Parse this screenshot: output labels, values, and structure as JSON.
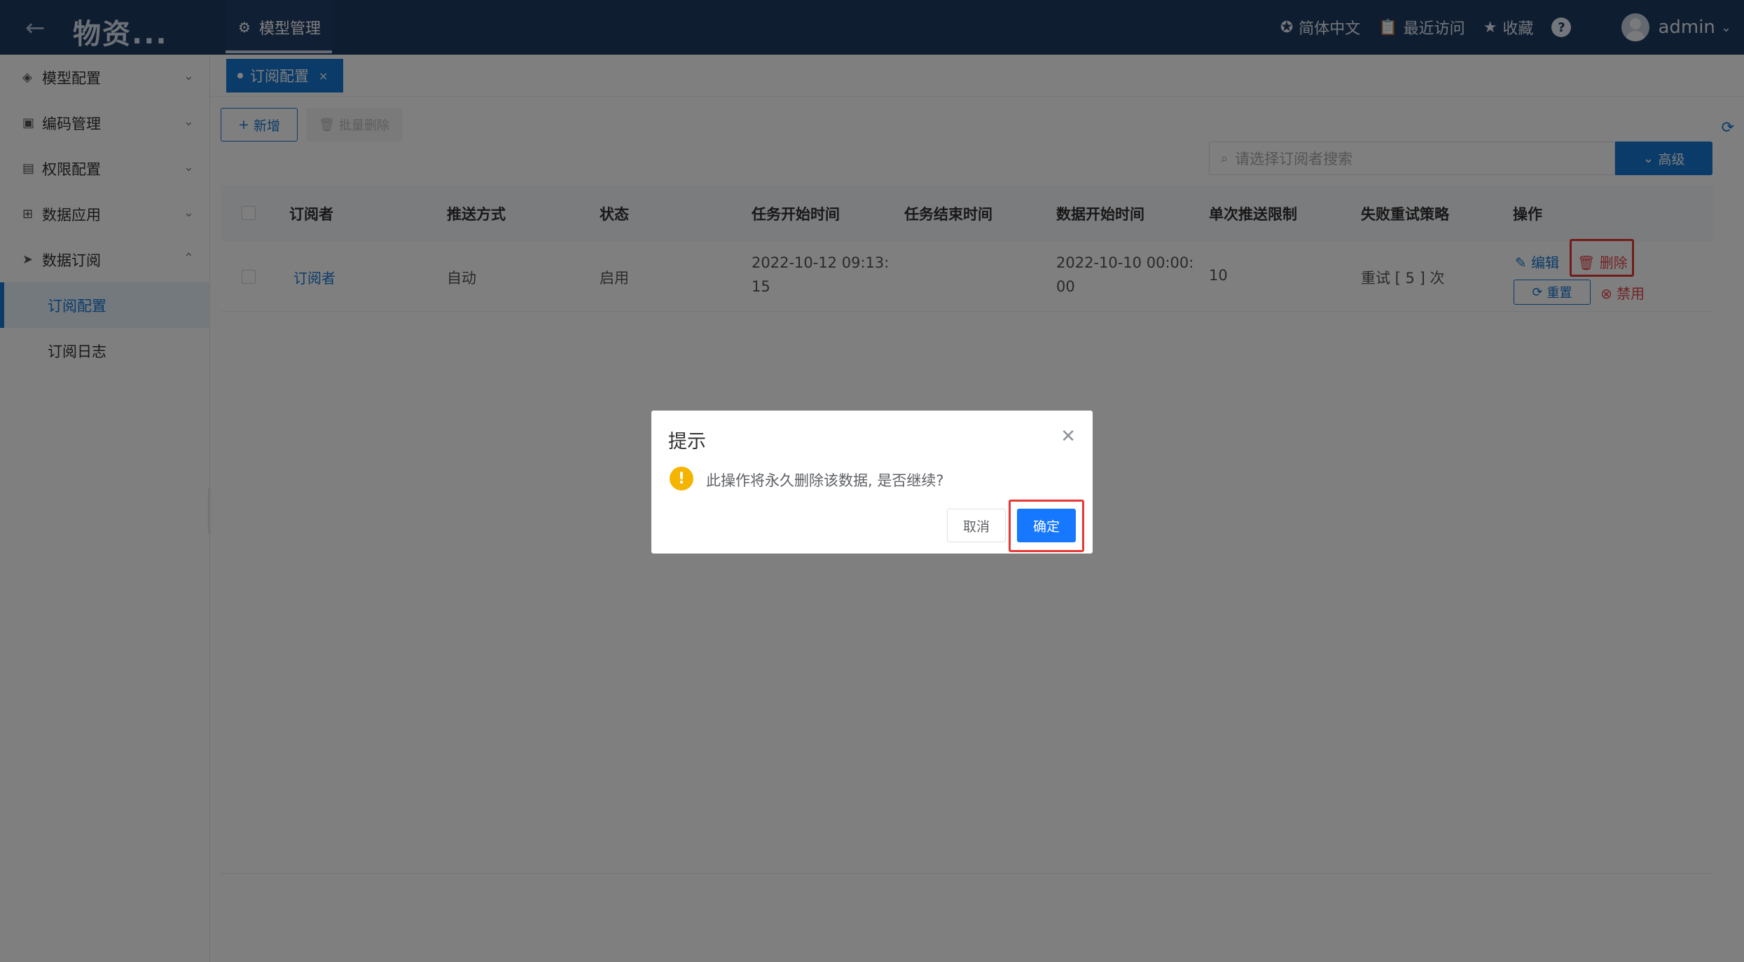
{
  "header": {
    "back_icon": "arrow-left-icon",
    "app_title": "物资...",
    "active_tab": {
      "icon": "gear-icon",
      "label": "模型管理"
    },
    "language": {
      "icon": "globe-icon",
      "label": "简体中文"
    },
    "recent": {
      "icon": "clipboard-icon",
      "label": "最近访问"
    },
    "favorite": {
      "icon": "star-icon",
      "label": "收藏"
    },
    "help": {
      "icon": "help-icon",
      "label": "?"
    },
    "user": {
      "name": "admin"
    }
  },
  "sidebar": {
    "items": [
      {
        "label": "模型配置",
        "icon": "layers-icon",
        "expanded": false
      },
      {
        "label": "编码管理",
        "icon": "code-icon",
        "expanded": false
      },
      {
        "label": "权限配置",
        "icon": "permission-icon",
        "expanded": false
      },
      {
        "label": "数据应用",
        "icon": "apps-icon",
        "expanded": false
      },
      {
        "label": "数据订阅",
        "icon": "send-icon",
        "expanded": true
      }
    ],
    "subitems": [
      {
        "label": "订阅配置",
        "active": true
      },
      {
        "label": "订阅日志",
        "active": false
      }
    ]
  },
  "page_tab": {
    "label": "订阅配置",
    "close": "×"
  },
  "toolbar": {
    "add_label": "新增",
    "batch_delete_label": "批量删除",
    "search_placeholder": "请选择订阅者搜索",
    "advanced_label": "高级"
  },
  "table": {
    "columns": [
      "订阅者",
      "推送方式",
      "状态",
      "任务开始时间",
      "任务结束时间",
      "数据开始时间",
      "单次推送限制",
      "失败重试策略",
      "操作"
    ],
    "rows": [
      {
        "subscriber": "订阅者",
        "push_mode": "自动",
        "status": "启用",
        "task_start_line1": "2022-10-12 09:13:",
        "task_start_line2": "15",
        "task_end": "",
        "data_start_line1": "2022-10-10 00:00:",
        "data_start_line2": "00",
        "push_limit": "10",
        "retry": "重试 [ 5 ] 次",
        "actions": {
          "edit": "编辑",
          "delete": "删除",
          "reset": "重置",
          "disable": "禁用"
        }
      }
    ]
  },
  "dialog": {
    "title": "提示",
    "message": "此操作将永久删除该数据, 是否继续?",
    "cancel": "取消",
    "confirm": "确定"
  },
  "colors": {
    "header_bg": "#1e3a63",
    "primary": "#1677d2",
    "danger": "#e5484d",
    "warning": "#f5b400",
    "highlight": "#e53935"
  }
}
